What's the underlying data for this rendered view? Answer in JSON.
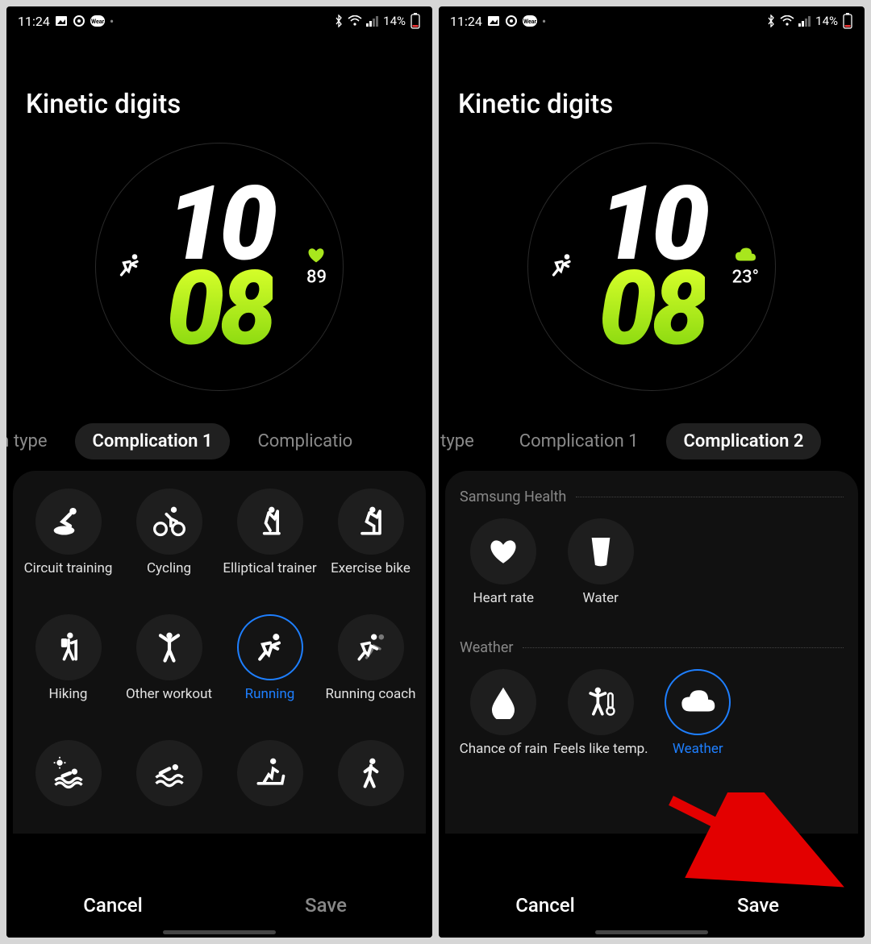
{
  "status": {
    "time": "11:24",
    "battery_text": "14%"
  },
  "page_title": "Kinetic digits",
  "watch": {
    "hour": "10",
    "minute": "08",
    "heart_value": "89",
    "temp_value": "23°"
  },
  "tabs_left": {
    "prev": "lication type",
    "active": "Complication 1",
    "next": "Complicatio"
  },
  "tabs_right": {
    "prev": "on type",
    "mid": "Complication 1",
    "active": "Complication 2"
  },
  "grid_items": [
    {
      "label": "Circuit training"
    },
    {
      "label": "Cycling"
    },
    {
      "label": "Elliptical trainer"
    },
    {
      "label": "Exercise bike"
    },
    {
      "label": "Hiking"
    },
    {
      "label": "Other workout"
    },
    {
      "label": "Running",
      "selected": true
    },
    {
      "label": "Running coach"
    }
  ],
  "sections": {
    "health": {
      "title": "Samsung Health",
      "items": [
        {
          "label": "Heart rate"
        },
        {
          "label": "Water"
        }
      ]
    },
    "weather": {
      "title": "Weather",
      "items": [
        {
          "label": "Chance of rain"
        },
        {
          "label": "Feels like temp."
        },
        {
          "label": "Weather",
          "selected": true
        }
      ]
    }
  },
  "footer": {
    "cancel": "Cancel",
    "save": "Save"
  }
}
